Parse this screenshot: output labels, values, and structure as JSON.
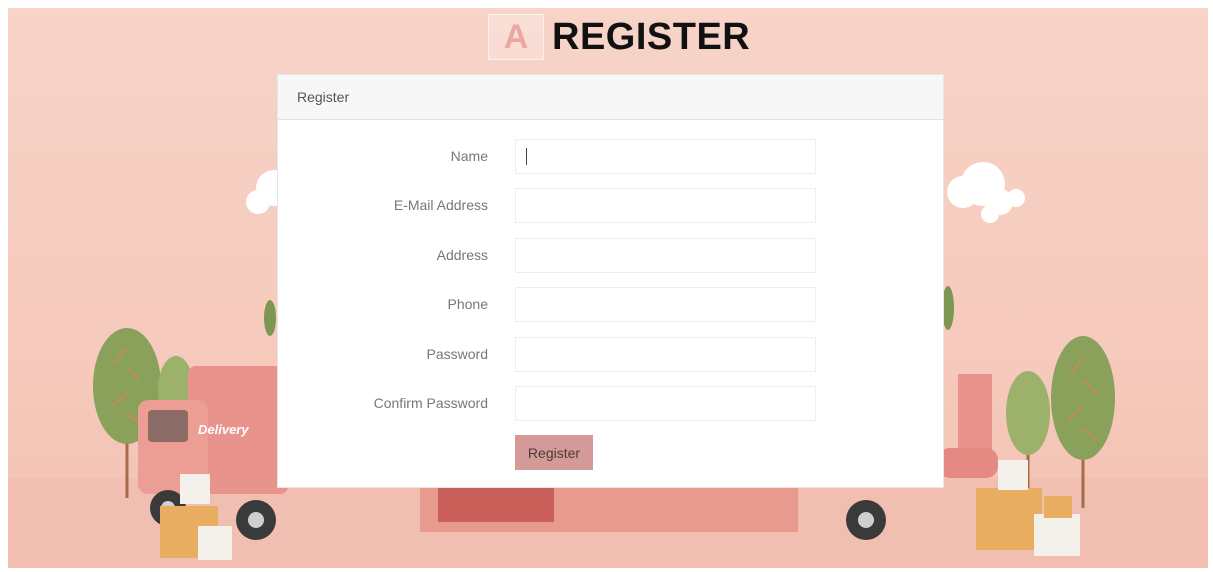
{
  "brand": {
    "logo_letter": "A",
    "title": "REGISTER"
  },
  "card": {
    "header": "Register"
  },
  "form": {
    "fields": [
      {
        "label": "Name",
        "value": "",
        "type": "text",
        "focused": true
      },
      {
        "label": "E-Mail Address",
        "value": "",
        "type": "email"
      },
      {
        "label": "Address",
        "value": "",
        "type": "text"
      },
      {
        "label": "Phone",
        "value": "",
        "type": "text"
      },
      {
        "label": "Password",
        "value": "",
        "type": "password"
      },
      {
        "label": "Confirm Password",
        "value": "",
        "type": "password"
      }
    ],
    "submit_label": "Register"
  },
  "background": {
    "truck_text": "Delivery"
  },
  "colors": {
    "background": "#f6cbbd",
    "button": "#d49a97",
    "logo_letter": "#e9a8a2",
    "title": "#111111"
  }
}
